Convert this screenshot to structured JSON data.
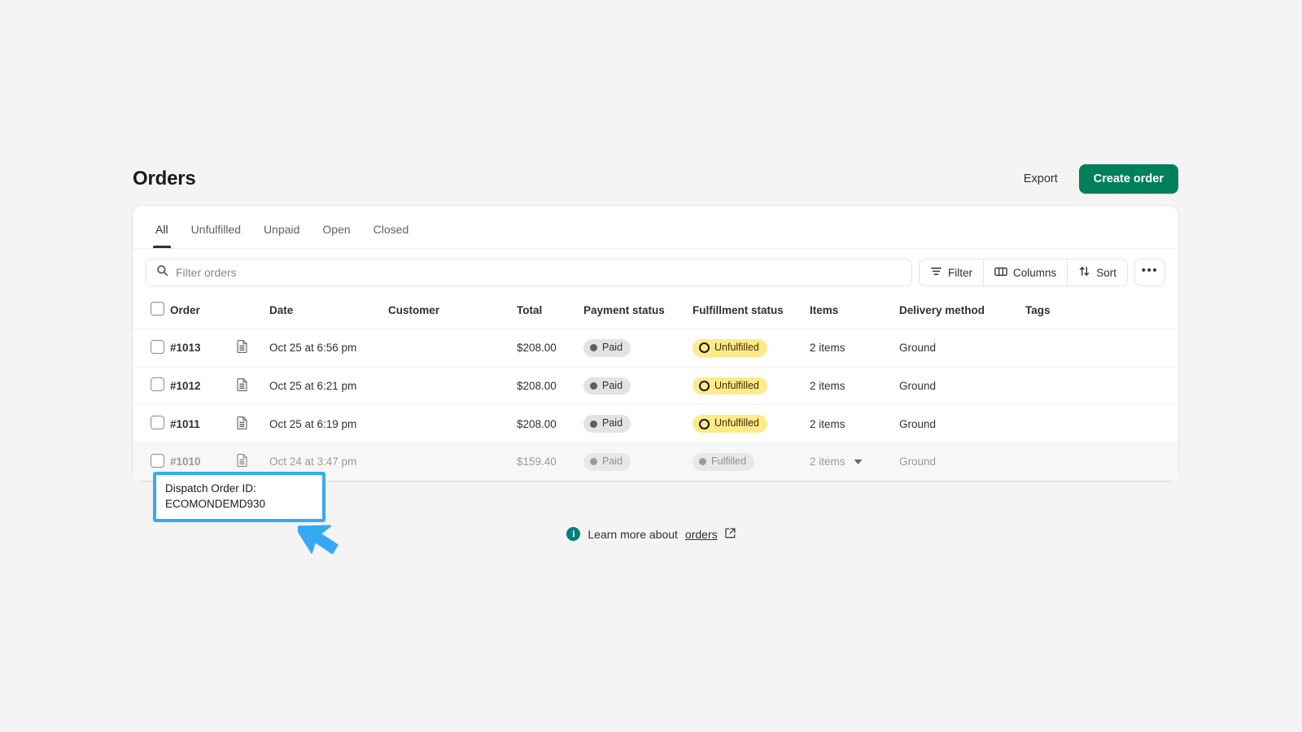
{
  "page": {
    "title": "Orders"
  },
  "header": {
    "export_label": "Export",
    "create_label": "Create order",
    "create_color": "#00805a"
  },
  "tabs": [
    {
      "label": "All",
      "active": true
    },
    {
      "label": "Unfulfilled",
      "active": false
    },
    {
      "label": "Unpaid",
      "active": false
    },
    {
      "label": "Open",
      "active": false
    },
    {
      "label": "Closed",
      "active": false
    }
  ],
  "toolbar": {
    "search_placeholder": "Filter orders",
    "search_value": "",
    "filter_label": "Filter",
    "columns_label": "Columns",
    "sort_label": "Sort",
    "more_label": "•••"
  },
  "table": {
    "columns": [
      "Order",
      "Date",
      "Customer",
      "Total",
      "Payment status",
      "Fulfillment status",
      "Items",
      "Delivery method",
      "Tags"
    ],
    "rows": [
      {
        "order": "#1013",
        "date": "Oct 25 at 6:56 pm",
        "customer": "",
        "total": "$208.00",
        "payment_status": "Paid",
        "fulfillment_status": "Unfulfilled",
        "items": "2 items",
        "delivery_method": "Ground",
        "tags": ""
      },
      {
        "order": "#1012",
        "date": "Oct 25 at 6:21 pm",
        "customer": "",
        "total": "$208.00",
        "payment_status": "Paid",
        "fulfillment_status": "Unfulfilled",
        "items": "2 items",
        "delivery_method": "Ground",
        "tags": ""
      },
      {
        "order": "#1011",
        "date": "Oct 25 at 6:19 pm",
        "customer": "",
        "total": "$208.00",
        "payment_status": "Paid",
        "fulfillment_status": "Unfulfilled",
        "items": "2 items",
        "delivery_method": "Ground",
        "tags": ""
      },
      {
        "order": "#1010",
        "date": "Oct 24 at 3:47 pm",
        "customer": "",
        "total": "$159.40",
        "payment_status": "Paid",
        "fulfillment_status": "Fulfilled",
        "items": "2 items",
        "delivery_method": "Ground",
        "tags": ""
      }
    ]
  },
  "footer": {
    "info_glyph": "i",
    "text": "Learn more about",
    "link_label": "orders"
  },
  "callout": {
    "line1": "Dispatch Order ID:",
    "line2": "ECOMONDEMD930",
    "border_color": "#36a9f4"
  }
}
